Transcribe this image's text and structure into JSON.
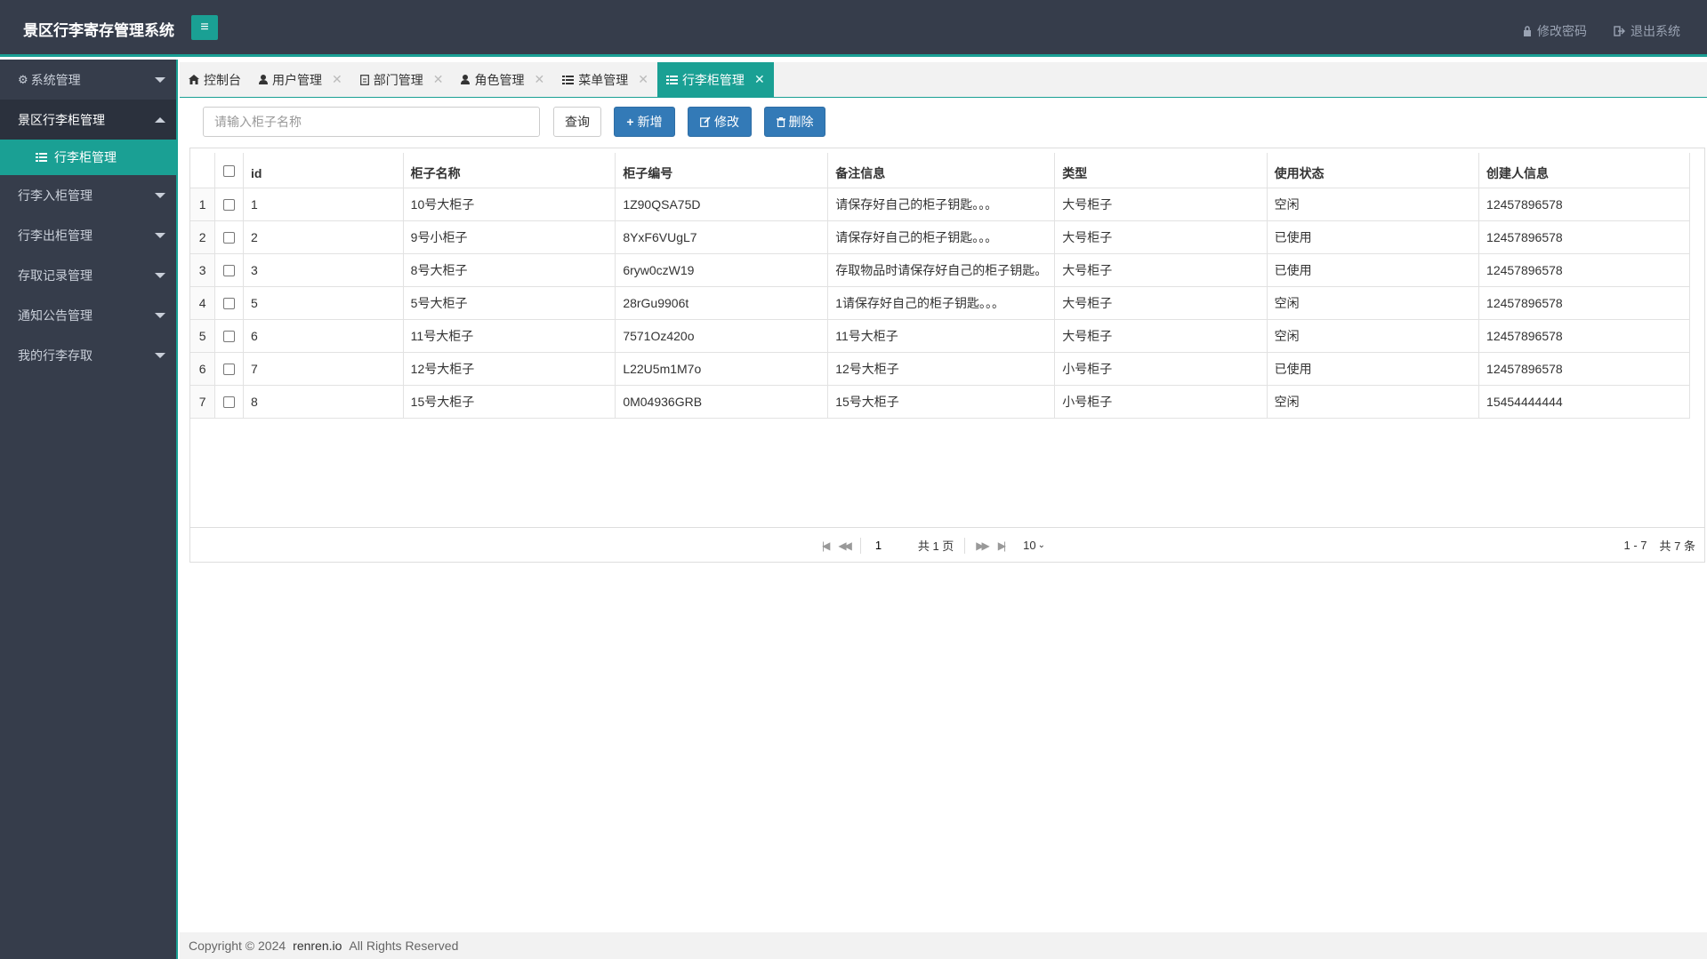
{
  "header": {
    "title": "景区行李寄存管理系统",
    "toggle_icon": "≡",
    "change_password": "修改密码",
    "logout": "退出系统"
  },
  "sidebar": {
    "items": [
      {
        "label": "系统管理",
        "icon": "gear-icon"
      },
      {
        "label": "景区行李柜管理"
      },
      {
        "label": "行李入柜管理"
      },
      {
        "label": "行李出柜管理"
      },
      {
        "label": "存取记录管理"
      },
      {
        "label": "通知公告管理"
      },
      {
        "label": "我的行李存取"
      }
    ],
    "sub_item": "行李柜管理"
  },
  "tabs": [
    {
      "label": "控制台",
      "icon": "home-icon"
    },
    {
      "label": "用户管理",
      "icon": "user-icon"
    },
    {
      "label": "部门管理",
      "icon": "doc-icon"
    },
    {
      "label": "角色管理",
      "icon": "role-icon"
    },
    {
      "label": "菜单管理",
      "icon": "list-icon"
    },
    {
      "label": "行李柜管理",
      "icon": "list-icon"
    }
  ],
  "toolbar": {
    "search_placeholder": "请输入柜子名称",
    "query": "查询",
    "add": "新增",
    "edit": "修改",
    "delete": "删除"
  },
  "table": {
    "columns": [
      "id",
      "柜子名称",
      "柜子编号",
      "备注信息",
      "类型",
      "使用状态",
      "创建人信息"
    ],
    "rows": [
      [
        "1",
        "1",
        "10号大柜子",
        "1Z90QSA75D",
        "请保存好自己的柜子钥匙。。。",
        "大号柜子",
        "空闲",
        "12457896578"
      ],
      [
        "2",
        "2",
        "9号小柜子",
        "8YxF6VUgL7",
        "请保存好自己的柜子钥匙。。。",
        "大号柜子",
        "已使用",
        "12457896578"
      ],
      [
        "3",
        "3",
        "8号大柜子",
        "6ryw0czW19",
        "存取物品时请保存好自己的柜子钥匙。",
        "大号柜子",
        "已使用",
        "12457896578"
      ],
      [
        "4",
        "5",
        "5号大柜子",
        "28rGu9906t",
        "1请保存好自己的柜子钥匙。。。",
        "大号柜子",
        "空闲",
        "12457896578"
      ],
      [
        "5",
        "6",
        "11号大柜子",
        "7571Oz420o",
        "11号大柜子",
        "大号柜子",
        "空闲",
        "12457896578"
      ],
      [
        "6",
        "7",
        "12号大柜子",
        "L22U5m1M7o",
        "12号大柜子",
        "小号柜子",
        "已使用",
        "12457896578"
      ],
      [
        "7",
        "8",
        "15号大柜子",
        "0M04936GRB",
        "15号大柜子",
        "小号柜子",
        "空闲",
        "15454444444"
      ]
    ]
  },
  "pager": {
    "page": "1",
    "total_pages": "共 1 页",
    "page_size": "10",
    "range": "1 - 7",
    "total": "共 7 条"
  },
  "footer": {
    "copyright": "Copyright © 2024",
    "brand": "renren.io",
    "rights": "All Rights Reserved"
  },
  "colors": {
    "header_bg": "#363d4b",
    "accent": "#1aa094",
    "primary_button": "#337ab7"
  }
}
